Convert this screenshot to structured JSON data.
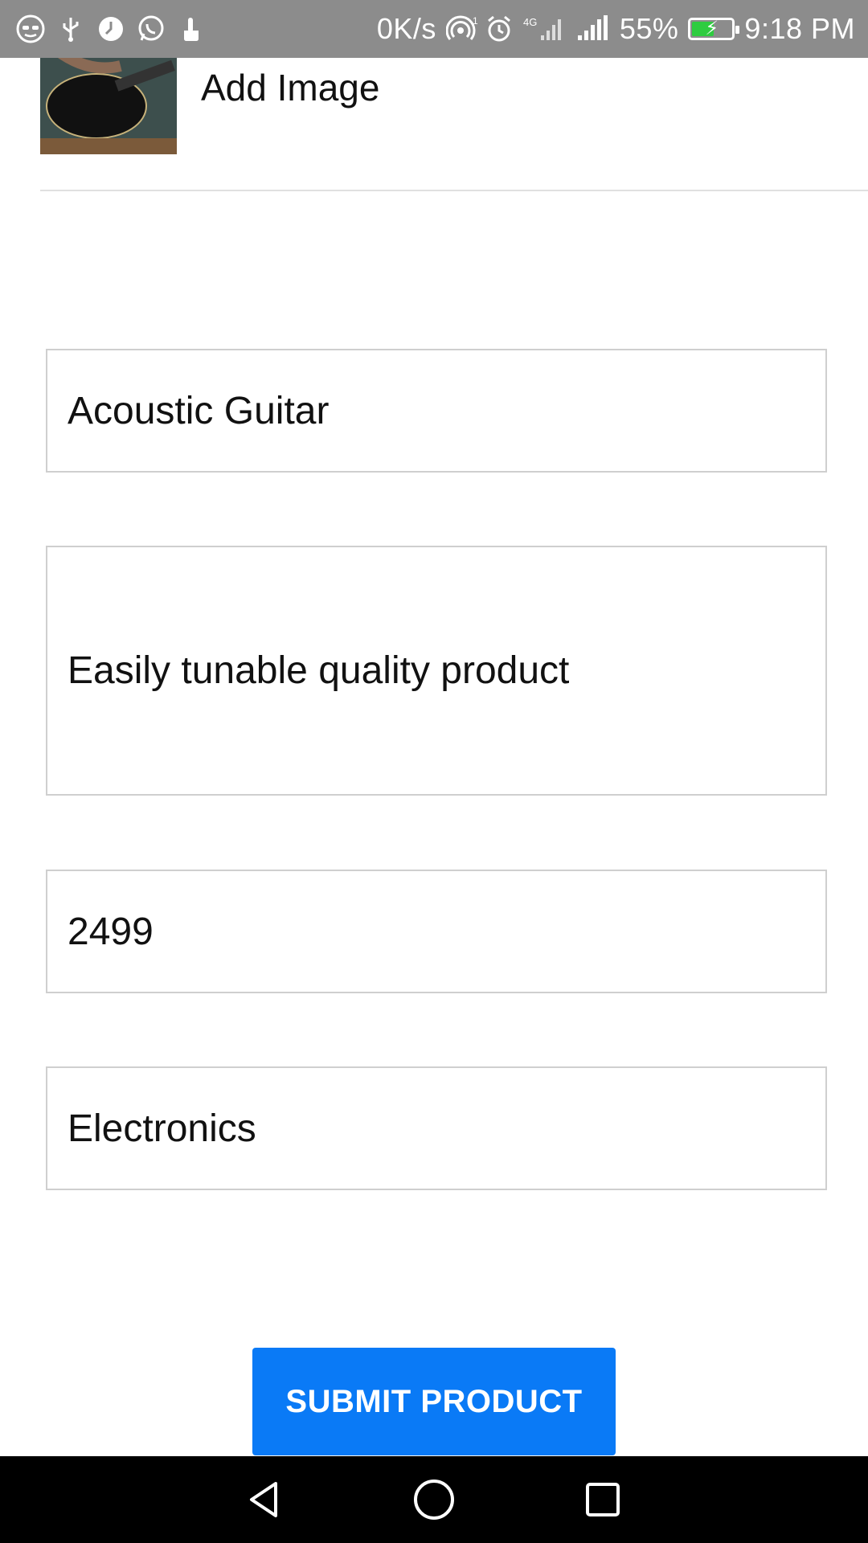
{
  "status_bar": {
    "net_speed": "0K/s",
    "hotspot_count": "1",
    "network_type": "4G",
    "battery_percent": "55%",
    "battery_level": 0.55,
    "time": "9:18 PM",
    "icons": [
      "incognito-icon",
      "usb-icon",
      "clock-icon",
      "whatsapp-icon",
      "touch-icon",
      "hotspot-icon",
      "alarm-icon",
      "signal-4g-icon",
      "signal-icon",
      "battery-icon"
    ]
  },
  "header": {
    "add_image_label": "Add Image",
    "thumbnail_alt": "guitar-photo"
  },
  "form": {
    "product_name": "Acoustic Guitar",
    "description": "Easily tunable quality product",
    "price": "2499",
    "category": "Electronics"
  },
  "actions": {
    "submit_label": "SUBMIT PRODUCT",
    "submit_color": "#0a7af6"
  },
  "nav_bar": {
    "icons": [
      "back-icon",
      "home-icon",
      "recents-icon"
    ]
  }
}
